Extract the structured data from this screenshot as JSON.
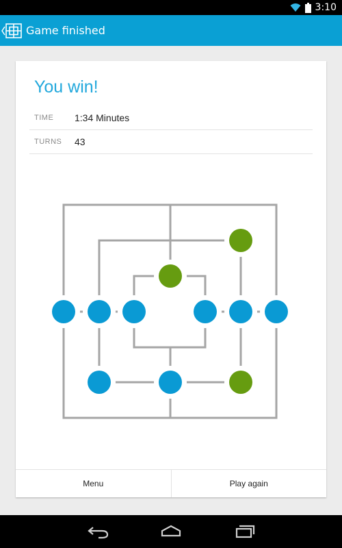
{
  "status_bar": {
    "time": "3:10",
    "icons": [
      "wifi-icon",
      "battery-icon"
    ]
  },
  "action_bar": {
    "title": "Game finished",
    "up_icon": "chevron-left-icon",
    "app_icon": "board-icon",
    "color": "#0aa0d4"
  },
  "result": {
    "headline": "You win!",
    "stats": [
      {
        "label": "TIME",
        "value": "1:34 Minutes"
      },
      {
        "label": "TURNS",
        "value": "43"
      }
    ]
  },
  "board": {
    "player_color": "#0a9ad4",
    "opponent_color": "#669c10",
    "pieces": {
      "a1": "blue",
      "d1": "blue",
      "g1": "blue",
      "a4": "blue",
      "b4": "blue",
      "c4": "blue",
      "e4": "blue",
      "f4": "blue",
      "g4": "blue",
      "f6": "green",
      "d5": "green",
      "f2": "green"
    }
  },
  "buttons": {
    "menu": "Menu",
    "play_again": "Play again"
  },
  "nav_bar": {
    "icons": [
      "back-icon",
      "home-icon",
      "recents-icon"
    ]
  }
}
